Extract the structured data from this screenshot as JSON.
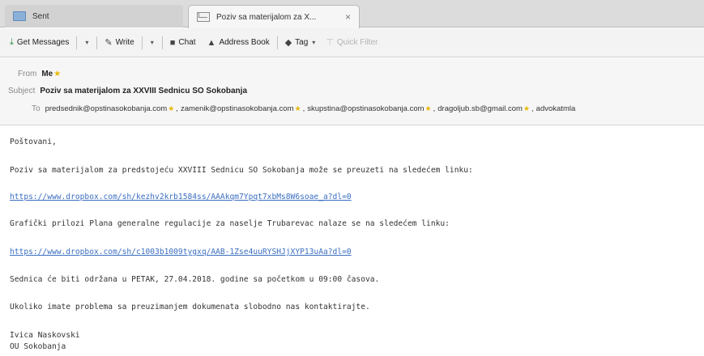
{
  "tabs": [
    {
      "label": "Sent"
    },
    {
      "label": "Poziv sa materijalom za X...",
      "close": "×"
    }
  ],
  "toolbar": {
    "get_messages": "Get Messages",
    "write": "Write",
    "chat": "Chat",
    "address_book": "Address Book",
    "tag": "Tag",
    "quick_filter": "Quick Filter",
    "dropdown_glyph": "▾"
  },
  "header": {
    "from_label": "From",
    "from_value": "Me",
    "subject_label": "Subject",
    "subject_value": "Poziv sa materijalom za XXVIII Sednicu SO Sokobanja",
    "to_label": "To",
    "recipients": [
      "predsednik@opstinasokobanja.com",
      "zamenik@opstinasokobanja.com",
      "skupstina@opstinasokobanja.com",
      "dragoljub.sb@gmail.com",
      "advokatmla"
    ]
  },
  "body": {
    "greeting": "Poštovani,",
    "para1": "Poziv sa materijalom za predstojeću XXVIII Sednicu SO Sokobanja može se preuzeti na sledećem linku:",
    "link1": "https://www.dropbox.com/sh/kezhv2krb1584ss/AAAkqm7Ypqt7xbMs8W6soae_a?dl=0",
    "para2": "Grafički prilozi Plana generalne regulacije za naselje Trubarevac nalaze se na sledećem linku:",
    "link2": "https://www.dropbox.com/sh/c1003b1009tygxq/AAB-1Zse4uuRYSHJjXYP13uAa?dl=0",
    "para3": "Sednica će biti održana u PETAK, 27.04.2018. godine sa početkom u 09:00 časova.",
    "para4": "Ukoliko imate problema sa preuzimanjem dokumenata slobodno nas kontaktirajte.",
    "signature_name": "Ivica Naskovski",
    "signature_org": "OU Sokobanja"
  }
}
